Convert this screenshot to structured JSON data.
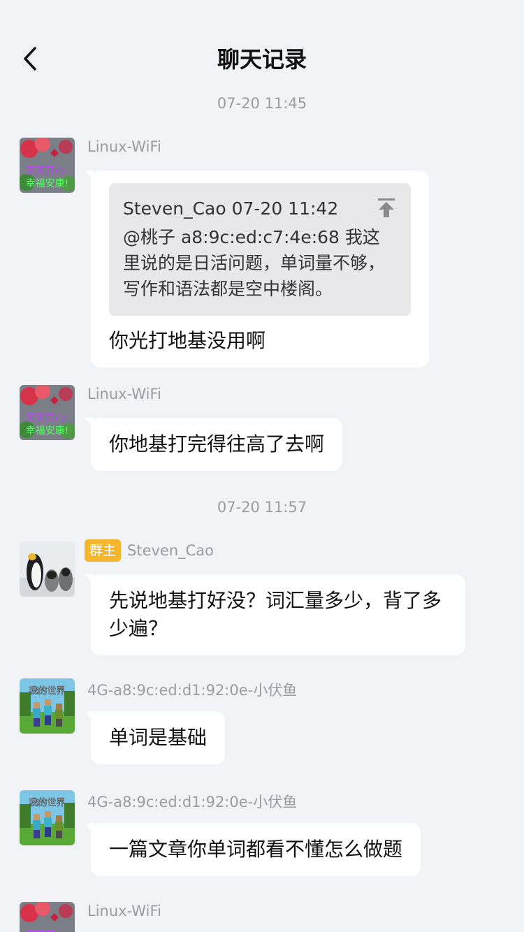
{
  "header": {
    "title": "聊天记录"
  },
  "times": [
    "07-20 11:45",
    "07-20 11:57"
  ],
  "messages": [
    {
      "sender": "Linux-WiFi",
      "quote_header": "Steven_Cao 07-20 11:42",
      "quote_text": "@桃子 a8:9c:ed:c7:4e:68 我这里说的是日活问题，单词量不够，写作和语法都是空中楼阁。",
      "text": "你光打地基没用啊"
    },
    {
      "sender": "Linux-WiFi",
      "text": "你地基打完得往高了去啊"
    },
    {
      "sender": "Steven_Cao",
      "badge": "群主",
      "text": "先说地基打好没？词汇量多少，背了多少遍？"
    },
    {
      "sender": "4G-a8:9c:ed:d1:92:0e-小伏鱼",
      "text": "单词是基础"
    },
    {
      "sender": "4G-a8:9c:ed:d1:92:0e-小伏鱼",
      "text": "一篇文章你单词都看不懂怎么做题"
    },
    {
      "sender": "Linux-WiFi"
    }
  ],
  "avatar_texts": {
    "flowers_line1": "天天开心!",
    "flowers_line2": "幸福安康!",
    "game_title": "我的世界"
  },
  "colors": {
    "background": "#f2f3f7",
    "bubble": "#ffffff",
    "badge": "#f5b62b",
    "meta_text": "#9a9ca3"
  }
}
